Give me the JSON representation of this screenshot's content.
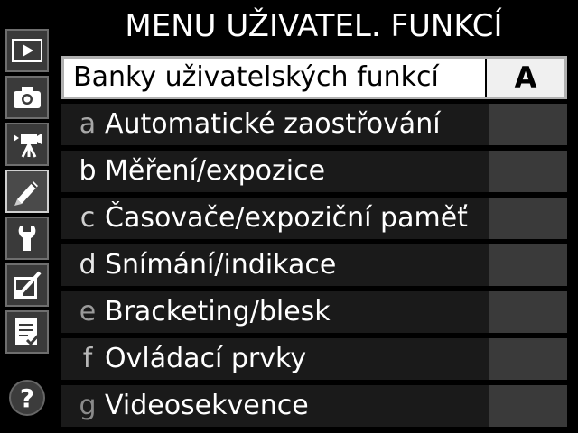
{
  "header": {
    "title": "MENU UŽIVATEL. FUNKCÍ"
  },
  "sidebar": {
    "tabs": [
      {
        "icon": "playback-icon"
      },
      {
        "icon": "camera-icon"
      },
      {
        "icon": "movie-icon"
      },
      {
        "icon": "pencil-icon"
      },
      {
        "icon": "wrench-icon"
      },
      {
        "icon": "retouch-icon"
      },
      {
        "icon": "my-menu-icon"
      }
    ],
    "help_label": "?"
  },
  "menu": {
    "items": [
      {
        "label": "Banky uživatelských funkcí",
        "value": "A"
      },
      {
        "letter": "a",
        "label": "Automatické zaostřování",
        "letter_color": "#a8a8a8"
      },
      {
        "letter": "b",
        "label": "Měření/expozice",
        "letter_color": "#ffffff"
      },
      {
        "letter": "c",
        "label": "Časovače/expoziční paměť",
        "letter_color": "#cfcfcf"
      },
      {
        "letter": "d",
        "label": "Snímání/indikace",
        "letter_color": "#e8e8e8"
      },
      {
        "letter": "e",
        "label": "Bracketing/blesk",
        "letter_color": "#9a9a9a"
      },
      {
        "letter": "f",
        "label": "Ovládací prvky",
        "letter_color": "#b8b8b8"
      },
      {
        "letter": "g",
        "label": "Videosekvence",
        "letter_color": "#8a8a8a"
      }
    ]
  }
}
